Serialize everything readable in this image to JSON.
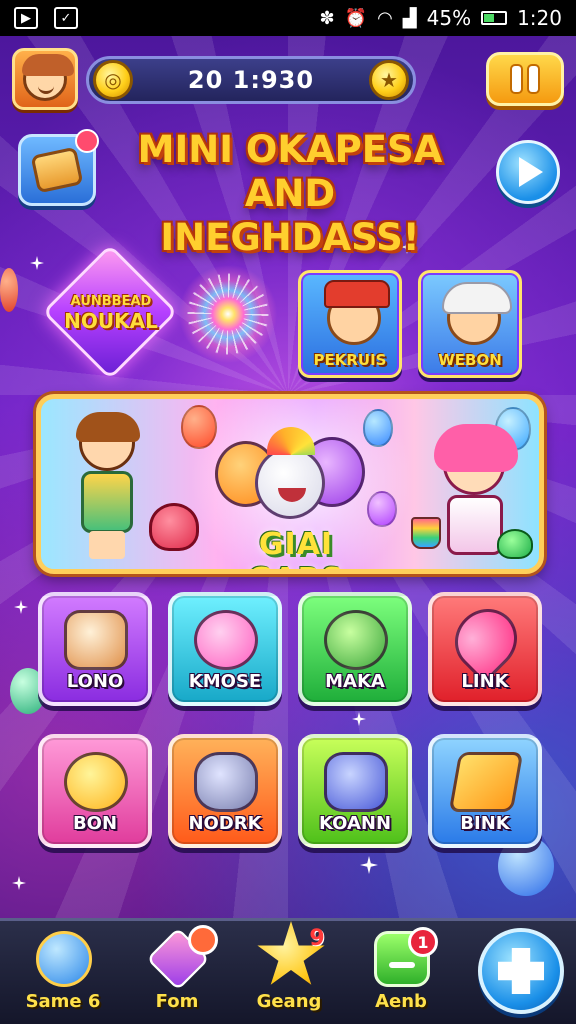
{
  "status_bar": {
    "battery_percent": "45%",
    "time": "1:20"
  },
  "hud": {
    "score": "20 1:930"
  },
  "title": {
    "line1": "MINI OKAPESA",
    "line2": "AND INEGHDASS!"
  },
  "featured": {
    "gem_badge_top": "AUNBBEAD",
    "gem_badge_bottom": "NOUKAL",
    "character_cards": [
      {
        "label": "PEKRUIS"
      },
      {
        "label": "WEBON"
      }
    ],
    "banner_title": "GIAI GABS"
  },
  "games": [
    {
      "label": "LONO"
    },
    {
      "label": "KMOSE"
    },
    {
      "label": "MAKA"
    },
    {
      "label": "LINK"
    },
    {
      "label": "BON"
    },
    {
      "label": "NODRK"
    },
    {
      "label": "KOANN"
    },
    {
      "label": "BINK"
    }
  ],
  "bottom_nav": {
    "items": [
      {
        "label": "Same 6",
        "badge": ""
      },
      {
        "label": "Fom",
        "badge": ""
      },
      {
        "label": "Geang",
        "badge": "9"
      },
      {
        "label": "Aenb",
        "badge": "1"
      }
    ]
  },
  "colors": {
    "background": "#5a1aa8",
    "accent_gold": "#ffcf2e",
    "title_outline": "#c2410c",
    "nav_bar": "#1c1f36"
  }
}
